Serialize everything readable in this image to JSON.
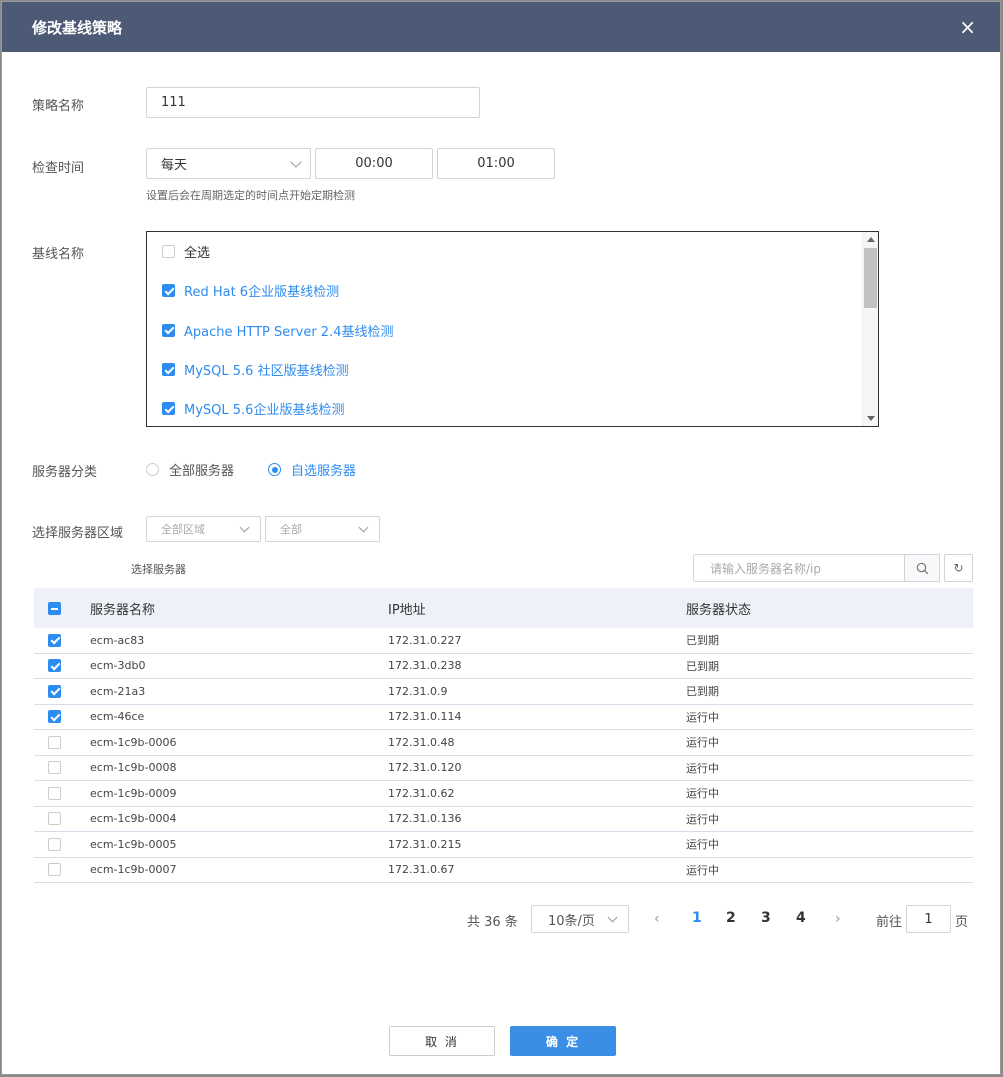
{
  "dialog": {
    "title": "修改基线策略",
    "close_glyph": "×"
  },
  "policy_name": {
    "label": "策略名称",
    "value": "111"
  },
  "check_time": {
    "label": "检查时间",
    "period": "每天",
    "start": "00:00",
    "end": "01:00",
    "hint": "设置后会在周期选定的时间点开始定期检测"
  },
  "baseline": {
    "label": "基线名称",
    "select_all": "全选",
    "items": [
      "Red Hat 6企业版基线检测",
      "Apache HTTP Server 2.4基线检测",
      "MySQL 5.6 社区版基线检测",
      "MySQL 5.6企业版基线检测"
    ]
  },
  "server_category": {
    "label": "服务器分类",
    "option_all": "全部服务器",
    "option_custom": "自选服务器"
  },
  "server_region": {
    "label": "选择服务器区域",
    "region": "全部区域",
    "zone": "全部"
  },
  "select_server_label": "选择服务器",
  "search": {
    "placeholder": "请输入服务器名称/ip",
    "refresh_glyph": "↻"
  },
  "table": {
    "headers": [
      "服务器名称",
      "IP地址",
      "服务器状态"
    ],
    "rows": [
      {
        "name": "ecm-ac83",
        "ip": "172.31.0.227",
        "status": "已到期",
        "checked": true
      },
      {
        "name": "ecm-3db0",
        "ip": "172.31.0.238",
        "status": "已到期",
        "checked": true
      },
      {
        "name": "ecm-21a3",
        "ip": "172.31.0.9",
        "status": "已到期",
        "checked": true
      },
      {
        "name": "ecm-46ce",
        "ip": "172.31.0.114",
        "status": "运行中",
        "checked": true
      },
      {
        "name": "ecm-1c9b-0006",
        "ip": "172.31.0.48",
        "status": "运行中",
        "checked": false
      },
      {
        "name": "ecm-1c9b-0008",
        "ip": "172.31.0.120",
        "status": "运行中",
        "checked": false
      },
      {
        "name": "ecm-1c9b-0009",
        "ip": "172.31.0.62",
        "status": "运行中",
        "checked": false
      },
      {
        "name": "ecm-1c9b-0004",
        "ip": "172.31.0.136",
        "status": "运行中",
        "checked": false
      },
      {
        "name": "ecm-1c9b-0005",
        "ip": "172.31.0.215",
        "status": "运行中",
        "checked": false
      },
      {
        "name": "ecm-1c9b-0007",
        "ip": "172.31.0.67",
        "status": "运行中",
        "checked": false
      }
    ]
  },
  "pagination": {
    "total": "共 36 条",
    "page_size": "10条/页",
    "prev": "‹",
    "next": "›",
    "pages": [
      "1",
      "2",
      "3",
      "4"
    ],
    "goto": "前往",
    "goto_value": "1",
    "page_unit": "页"
  },
  "buttons": {
    "cancel": "取 消",
    "ok": "确 定"
  },
  "colors": {
    "header_bg": "#4d5a75",
    "accent": "#2d8cf0",
    "primary_button": "#3a8ee6"
  }
}
